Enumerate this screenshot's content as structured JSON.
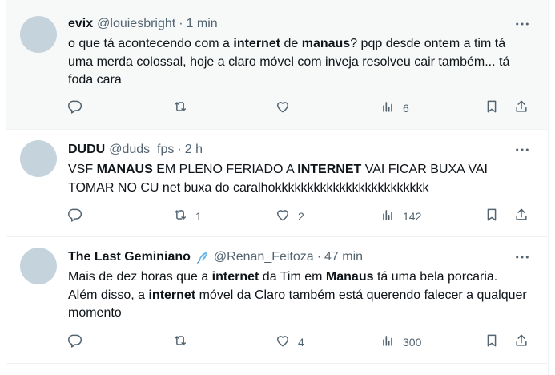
{
  "tweets": [
    {
      "name": "evix",
      "handle": "@louiesbright",
      "time": "1 min",
      "text_parts": [
        {
          "t": "o que tá acontecendo com a ",
          "b": false
        },
        {
          "t": "internet",
          "b": true
        },
        {
          "t": " de ",
          "b": false
        },
        {
          "t": "manaus",
          "b": true
        },
        {
          "t": "? pqp desde ontem a tim tá uma merda colossal, hoje a claro móvel com inveja resolveu cair também... tá foda cara",
          "b": false
        }
      ],
      "replies": "",
      "retweets": "",
      "likes": "",
      "views": "6"
    },
    {
      "name": "DUDU",
      "handle": "@duds_fps",
      "time": "2 h",
      "text_parts": [
        {
          "t": "VSF ",
          "b": false
        },
        {
          "t": "MANAUS",
          "b": true
        },
        {
          "t": " EM PLENO FERIADO A ",
          "b": false
        },
        {
          "t": "INTERNET",
          "b": true
        },
        {
          "t": " VAI FICAR BUXA VAI TOMAR NO CU net buxa do caralhokkkkkkkkkkkkkkkkkkkkkkkk",
          "b": false
        }
      ],
      "replies": "",
      "retweets": "1",
      "likes": "2",
      "views": "142"
    },
    {
      "name": "The Last Geminiano",
      "handle": "@Renan_Feitoza",
      "time": "47 min",
      "text_parts": [
        {
          "t": "Mais de dez horas que a ",
          "b": false
        },
        {
          "t": "internet",
          "b": true
        },
        {
          "t": " da Tim em ",
          "b": false
        },
        {
          "t": "Manaus",
          "b": true
        },
        {
          "t": " tá uma bela porcaria. Além disso, a ",
          "b": false
        },
        {
          "t": "internet",
          "b": true
        },
        {
          "t": " móvel da Claro também está querendo falecer a qualquer momento",
          "b": false
        }
      ],
      "replies": "",
      "retweets": "",
      "likes": "4",
      "views": "300"
    }
  ],
  "icons": {
    "reply": "reply-icon",
    "retweet": "retweet-icon",
    "like": "like-icon",
    "views": "views-icon",
    "bookmark": "bookmark-icon",
    "share": "share-icon",
    "more": "more-icon",
    "emoji_after_name_3": "feather-emoji-icon"
  },
  "colors": {
    "text": "#0f1419",
    "muted": "#536471",
    "avatar": "#c4d3dc",
    "hover_bg": "#f7f9f9"
  }
}
